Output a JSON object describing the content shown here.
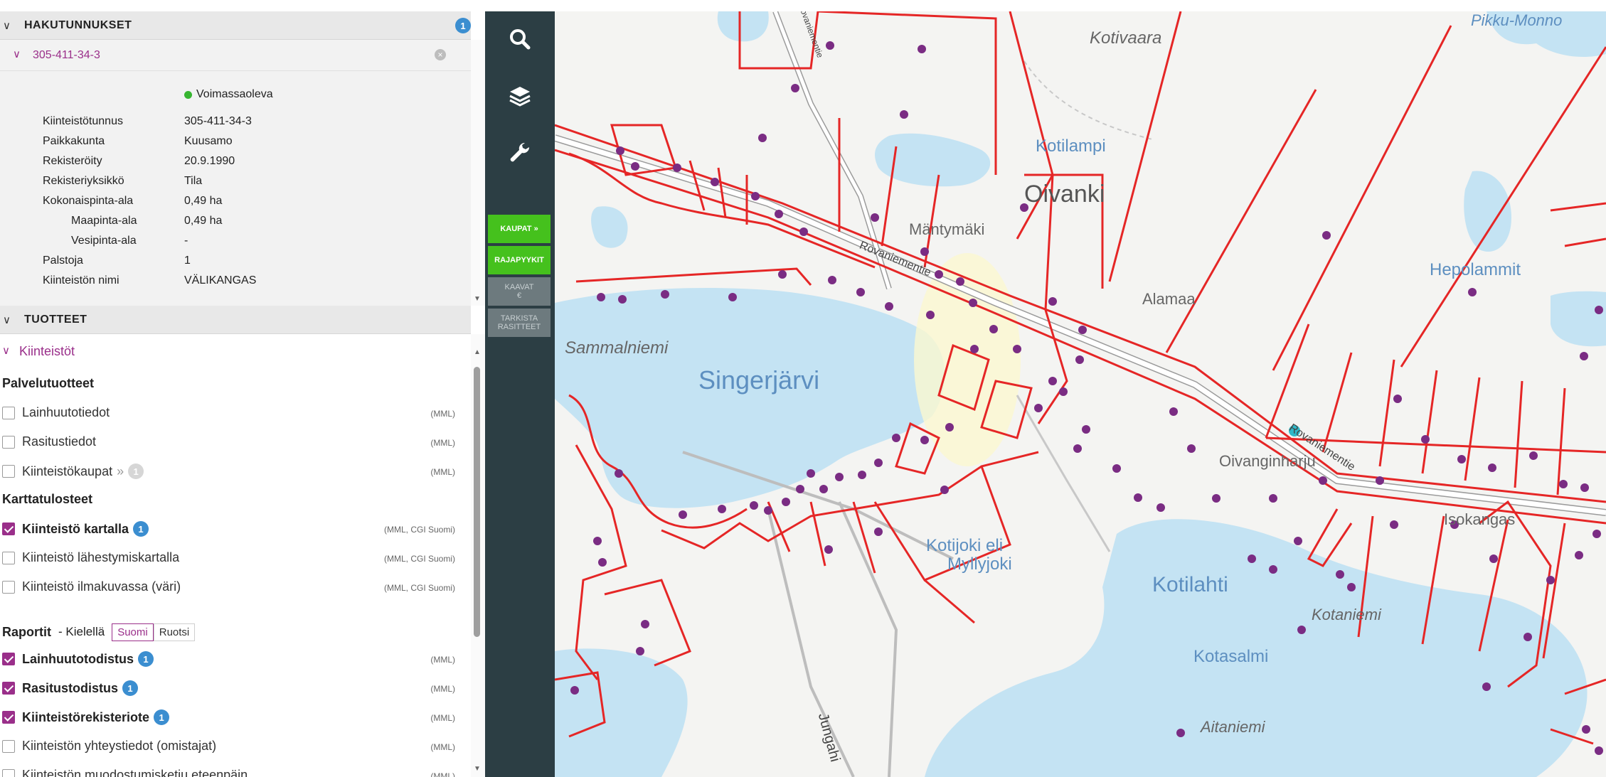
{
  "search_codes": {
    "header_title": "HAKUTUNNUKSET",
    "count": "1",
    "item_id": "305-411-34-3",
    "status": "Voimassaoleva",
    "details": [
      {
        "key": "Kiinteistötunnus",
        "value": "305-411-34-3",
        "indent": false
      },
      {
        "key": "Paikkakunta",
        "value": "Kuusamo",
        "indent": false
      },
      {
        "key": "Rekisteröity",
        "value": "20.9.1990",
        "indent": false
      },
      {
        "key": "Rekisteriyksikkö",
        "value": "Tila",
        "indent": false
      },
      {
        "key": "Kokonaispinta-ala",
        "value": "0,49 ha",
        "indent": false
      },
      {
        "key": "Maapinta-ala",
        "value": "0,49 ha",
        "indent": true
      },
      {
        "key": "Vesipinta-ala",
        "value": "-",
        "indent": true
      },
      {
        "key": "Palstoja",
        "value": "1",
        "indent": false
      },
      {
        "key": "Kiinteistön nimi",
        "value": "VÄLIKANGAS",
        "indent": false
      }
    ]
  },
  "products": {
    "header_title": "TUOTTEET",
    "category": "Kiinteistöt",
    "groups": {
      "services": "Palvelutuotteet",
      "map_prints": "Karttatulosteet",
      "reports": "Raportit",
      "language_label": "- Kielellä",
      "languages": [
        "Suomi",
        "Ruotsi"
      ],
      "selected_language": "Suomi"
    },
    "service_items": [
      {
        "label": "Lainhuutotiedot",
        "source": "(MML)",
        "checked": false,
        "badge": "",
        "more": ""
      },
      {
        "label": "Rasitustiedot",
        "source": "(MML)",
        "checked": false,
        "badge": "",
        "more": ""
      },
      {
        "label": "Kiinteistökaupat",
        "source": "(MML)",
        "checked": false,
        "badge": "1",
        "more": "»"
      }
    ],
    "map_items": [
      {
        "label": "Kiinteistö kartalla",
        "source": "(MML, CGI Suomi)",
        "checked": true,
        "badge": "1"
      },
      {
        "label": "Kiinteistö lähestymiskartalla",
        "source": "(MML, CGI Suomi)",
        "checked": false,
        "badge": ""
      },
      {
        "label": "Kiinteistö ilmakuvassa (väri)",
        "source": "(MML, CGI Suomi)",
        "checked": false,
        "badge": ""
      }
    ],
    "report_items": [
      {
        "label": "Lainhuutotodistus",
        "source": "(MML)",
        "checked": true,
        "badge": "1"
      },
      {
        "label": "Rasitustodistus",
        "source": "(MML)",
        "checked": true,
        "badge": "1"
      },
      {
        "label": "Kiinteistörekisteriote",
        "source": "(MML)",
        "checked": true,
        "badge": "1"
      },
      {
        "label": "Kiinteistön yhteystiedot (omistajat)",
        "source": "(MML)",
        "checked": false,
        "badge": ""
      },
      {
        "label": "Kiinteistön muodostumisketju eteenpäin",
        "source": "(MML)",
        "checked": false,
        "badge": ""
      }
    ]
  },
  "toolbar": {
    "icons": [
      "search-icon",
      "layers-icon",
      "wrench-icon"
    ],
    "kaupat": "KAUPAT »",
    "rajapyykit": "RAJAPYYKIT",
    "kaavat_line1": "KAAVAT",
    "kaavat_line2": "€",
    "tarkista_line1": "TARKISTA",
    "tarkista_line2": "RASITTEET"
  },
  "map": {
    "labels": {
      "kotivaara": "Kotivaara",
      "pikku_monno": "Pikku-Monno",
      "kotilampi": "Kotilampi",
      "oivanki": "Oivanki",
      "mantymaki": "Mäntymäki",
      "hepolammit": "Hepolammit",
      "alamaa": "Alamaa",
      "sammalniemi": "Sammalniemi",
      "singerjarvi": "Singerjärvi",
      "oivanginharju": "Oivanginharju",
      "isokangas": "Isokangas",
      "kotijoki": "Kotijoki eli",
      "myllyjoki": "Myllyjoki",
      "kotilahti": "Kotilahti",
      "kotaniemi": "Kotaniemi",
      "kotasalmi": "Kotasalmi",
      "aitaniemi": "Aitaniemi",
      "rovaniementie_1": "Rovaniementie",
      "rovaniementie_2": "Rovaniementie",
      "jungahi": "Jungahi",
      "side_road": "Rovaniementie"
    },
    "colors": {
      "water": "#c4e3f3",
      "land": "#f4f4f2",
      "boundary": "#e52626",
      "road_fill": "#ffffff",
      "pin": "#7a2c83",
      "selected_pin": "#2fb8c8"
    }
  }
}
